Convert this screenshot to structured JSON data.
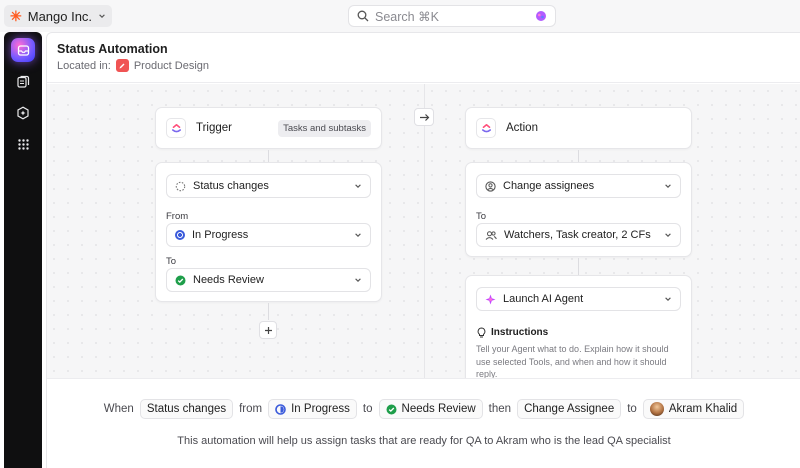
{
  "workspace": {
    "name": "Mango Inc."
  },
  "search": {
    "placeholder": "Search ⌘K"
  },
  "header": {
    "title": "Status Automation",
    "located_in_label": "Located in:",
    "location": "Product Design"
  },
  "trigger": {
    "title": "Trigger",
    "scope_chip": "Tasks and subtasks",
    "condition": "Status changes",
    "from_label": "From",
    "from_value": "In Progress",
    "to_label": "To",
    "to_value": "Needs Review"
  },
  "action": {
    "title": "Action",
    "first_action": "Change assignees",
    "to_label": "To",
    "assignees": "Watchers, Task creator, 2 CFs",
    "second_action": "Launch AI Agent",
    "instructions_title": "Instructions",
    "instructions_text": "Tell your Agent what to do. Explain how it should use selected Tools, and when and how it should reply."
  },
  "summary": {
    "when": "When",
    "trigger": "Status changes",
    "from": "from",
    "from_status": "In Progress",
    "to": "to",
    "to_status": "Needs Review",
    "then": "then",
    "action": "Change Assignee",
    "to2": "to",
    "assignee": "Akram Khalid",
    "description": "This automation will help us assign tasks that are ready for QA to Akram who is the lead QA specialist"
  },
  "colors": {
    "in_progress": "#3b5bdb",
    "needs_review": "#1e9e4a",
    "location_badge": "#f05454",
    "workspace_logo": "#ff5a1f"
  }
}
